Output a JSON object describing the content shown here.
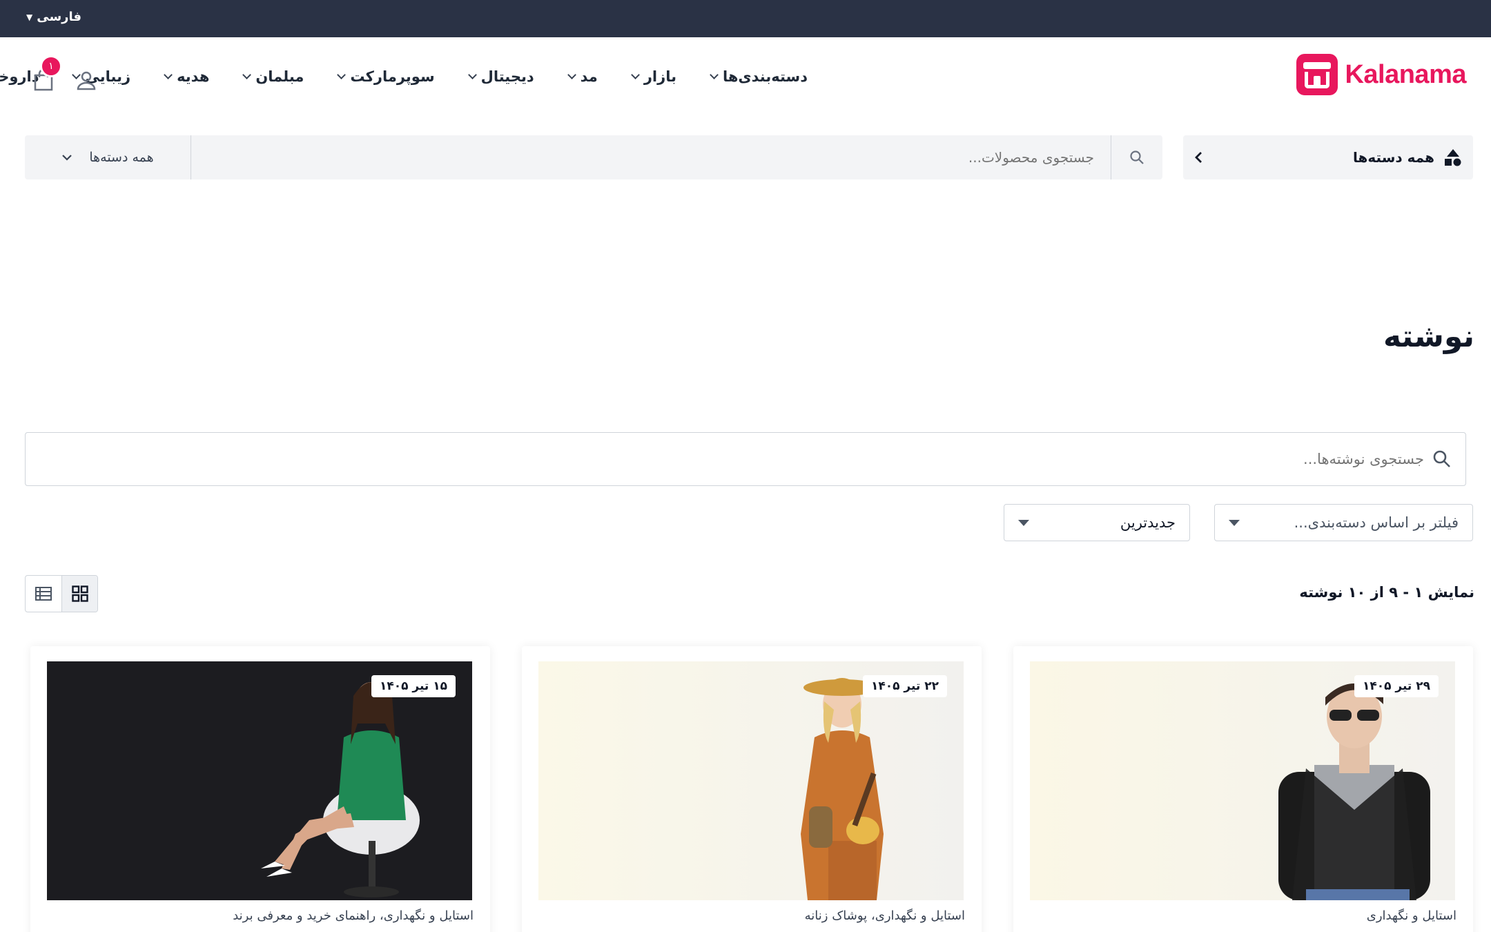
{
  "topbar": {
    "language": "فارسی"
  },
  "brand": {
    "name": "Kalanama",
    "color": "#e8175d"
  },
  "nav": {
    "items": [
      {
        "label": "دسته‌بندی‌ها"
      },
      {
        "label": "بازار"
      },
      {
        "label": "مد"
      },
      {
        "label": "دیجیتال"
      },
      {
        "label": "سوپرمارکت"
      },
      {
        "label": "مبلمان"
      },
      {
        "label": "هدیه"
      },
      {
        "label": "زیبایی"
      },
      {
        "label": "داروخانه"
      }
    ]
  },
  "header_icons": {
    "user_icon": "user-icon",
    "cart_icon": "cart-icon",
    "cart_count": "۱"
  },
  "categories_button": {
    "label": "همه دسته‌ها",
    "icon": "shapes-icon"
  },
  "product_search": {
    "placeholder": "جستجوی محصولات...",
    "category_select": "همه دسته‌ها"
  },
  "page": {
    "title": "نوشته"
  },
  "blog_search": {
    "placeholder": "جستجوی نوشته‌ها..."
  },
  "filters": {
    "category_placeholder": "فیلتر بر اساس دسته‌بندی...",
    "sort_selected": "جدیدترین"
  },
  "results": {
    "count_text": "نمایش ۱ - ۹ از ۱۰ نوشته"
  },
  "view_toggle": {
    "active": "grid"
  },
  "posts": [
    {
      "date": "۲۹ تیر ۱۴۰۵",
      "categories": [
        "استایل و نگهداری"
      ]
    },
    {
      "date": "۲۲ تیر ۱۴۰۵",
      "categories": [
        "استایل و نگهداری،",
        "پوشاک زنانه"
      ]
    },
    {
      "date": "۱۵ تیر ۱۴۰۵",
      "categories": [
        "استایل و نگهداری،",
        "راهنمای خرید و معرفی برند"
      ]
    }
  ]
}
